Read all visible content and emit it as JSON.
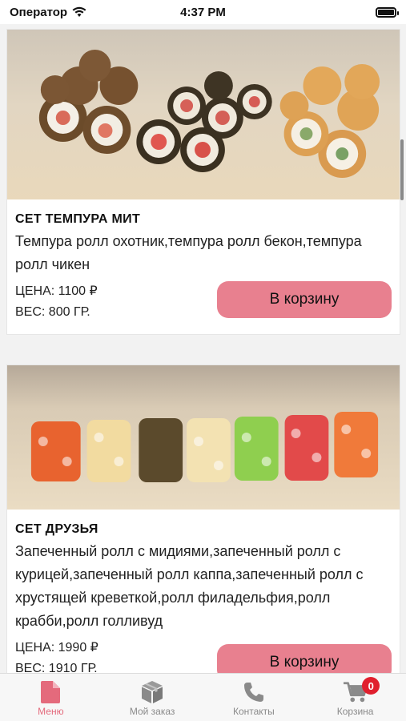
{
  "status_bar": {
    "carrier": "Оператор",
    "time": "4:37 PM"
  },
  "products": [
    {
      "title": "СЕТ ТЕМПУРА МИТ",
      "description": "Темпура ролл охотник,темпура ролл бекон,темпура ролл чикен",
      "price": "ЦЕНА: 1100 ₽",
      "weight": "ВЕС: 800 ГР.",
      "button_label": "В корзину"
    },
    {
      "title": "СЕТ ДРУЗЬЯ",
      "description": "Запеченный ролл с мидиями,запеченный ролл с курицей,запеченный ролл каппа,запеченный ролл с хрустящей креветкой,ролл филадельфия,ролл крабби,ролл голливуд",
      "price": "ЦЕНА: 1990 ₽",
      "weight": "ВЕС: 1910 ГР.",
      "button_label": "В корзину"
    }
  ],
  "tab_bar": {
    "items": [
      {
        "label": "Меню",
        "icon": "document-icon",
        "active": true
      },
      {
        "label": "Мой заказ",
        "icon": "box-icon",
        "active": false
      },
      {
        "label": "Контакты",
        "icon": "phone-icon",
        "active": false
      },
      {
        "label": "Корзина",
        "icon": "cart-icon",
        "active": false
      }
    ],
    "cart_badge": "0"
  },
  "colors": {
    "accent": "#e8808f",
    "active_tab": "#e46a7c",
    "badge": "#e0202e"
  }
}
